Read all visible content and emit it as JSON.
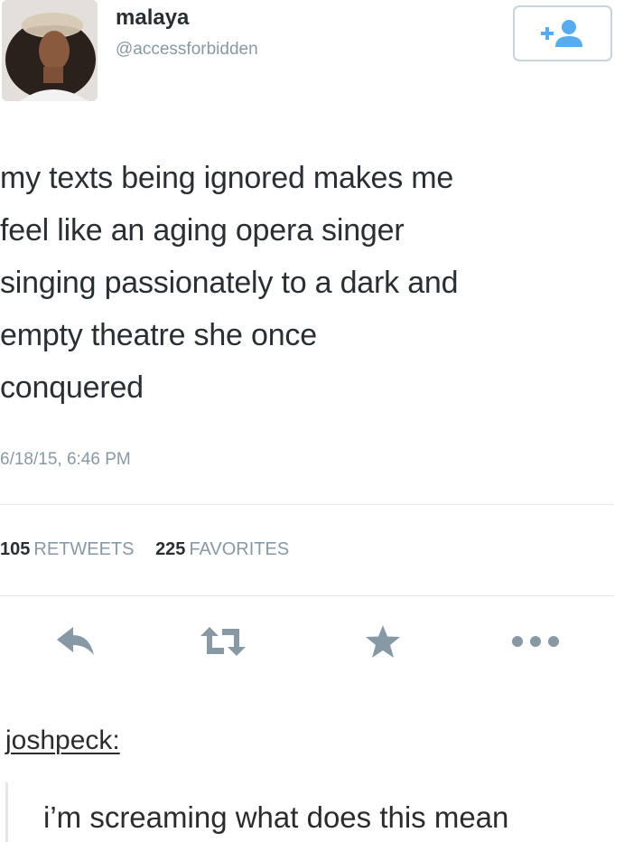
{
  "tweet": {
    "user": {
      "display_name": "malaya",
      "handle": "@accessforbidden"
    },
    "follow_icon": "add-user-icon",
    "text_lines": [
      "my texts being ignored makes me",
      "feel like an aging opera singer",
      "singing passionately to a dark and",
      "empty theatre she once",
      "conquered"
    ],
    "timestamp": "6/18/15, 6:46 PM",
    "stats": {
      "retweets_count": "105",
      "retweets_label": "RETWEETS",
      "favorites_count": "225",
      "favorites_label": "FAVORITES"
    },
    "actions": {
      "reply_icon": "reply-icon",
      "retweet_icon": "retweet-icon",
      "favorite_icon": "star-icon",
      "more_icon": "more-dots-icon"
    }
  },
  "reblog": {
    "author": "joshpeck:",
    "comment": "i’m screaming what does this mean"
  },
  "colors": {
    "text": "#292f33",
    "muted": "#8899a6",
    "icon": "#8899a6",
    "divider": "#e1e8ed",
    "follow_border": "#c9d3dc"
  }
}
